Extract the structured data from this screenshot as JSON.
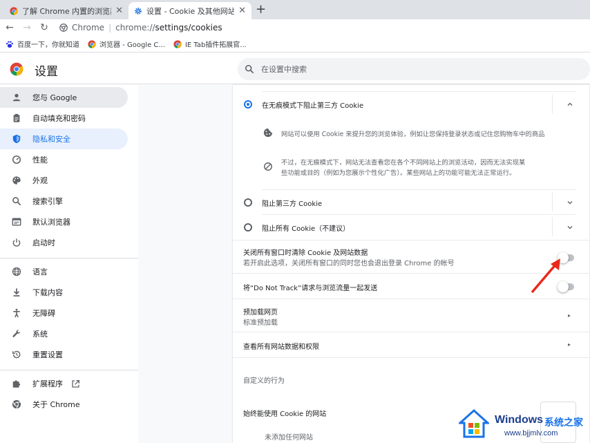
{
  "tabs": [
    {
      "label": "了解 Chrome 内置的浏览器工具",
      "active": false
    },
    {
      "label": "设置 - Cookie 及其他网站数据",
      "active": true
    }
  ],
  "omnibox": {
    "chip": "Chrome",
    "url_scheme": "chrome://",
    "url_path": "settings/cookies"
  },
  "bookmarks": [
    {
      "label": "百度一下，你就知道",
      "icon": "baidu-paw-icon"
    },
    {
      "label": "浏览器 - Google C...",
      "icon": "chrome-icon"
    },
    {
      "label": "IE Tab插件拓展官...",
      "icon": "chrome-icon"
    }
  ],
  "header": {
    "title": "设置",
    "search_placeholder": "在设置中搜索"
  },
  "sidebar": {
    "items": [
      {
        "label": "您与 Google",
        "icon": "person-icon"
      },
      {
        "label": "自动填充和密码",
        "icon": "clipboard-icon"
      },
      {
        "label": "隐私和安全",
        "icon": "shield-icon"
      },
      {
        "label": "性能",
        "icon": "speedometer-icon"
      },
      {
        "label": "外观",
        "icon": "palette-icon"
      },
      {
        "label": "搜索引擎",
        "icon": "search-icon"
      },
      {
        "label": "默认浏览器",
        "icon": "browser-icon"
      },
      {
        "label": "启动时",
        "icon": "power-icon"
      },
      {
        "label": "语言",
        "icon": "globe-icon"
      },
      {
        "label": "下载内容",
        "icon": "download-icon"
      },
      {
        "label": "无障碍",
        "icon": "accessibility-icon"
      },
      {
        "label": "系统",
        "icon": "wrench-icon"
      },
      {
        "label": "重置设置",
        "icon": "reset-icon"
      },
      {
        "label": "扩展程序",
        "icon": "puzzle-icon"
      },
      {
        "label": "关于 Chrome",
        "icon": "chrome-icon"
      }
    ]
  },
  "content": {
    "option_incognito": "在无痕模式下阻止第三方 Cookie",
    "detail_1": "网站可以使用 Cookie 来提升您的浏览体验，例如让您保持登录状态或记住您购物车中的商品",
    "detail_2_line1": "不过，在无痕模式下，网站无法查看您在各个不同网站上的浏览活动，因而无法实现某",
    "detail_2_line2": "些功能或目的（例如为您展示个性化广告）。某些网站上的功能可能无法正常运行。",
    "option_block_third": "阻止第三方 Cookie",
    "option_block_all": "阻止所有 Cookie（不建议）",
    "clear_on_exit_title": "关闭所有窗口时清除 Cookie 及网站数据",
    "clear_on_exit_sub": "若开启此选项，关闭所有窗口的同时您也会退出登录 Chrome 的帐号",
    "dnt_title": "将“Do Not Track”请求与浏览流量一起发送",
    "preload_title": "预加载网页",
    "preload_sub": "标准预加载",
    "view_all": "查看所有网站数据和权限",
    "custom_behavior": "自定义的行为",
    "always_allow": "始终能使用 Cookie 的网站",
    "no_sites": "未添加任何网站"
  },
  "watermark": {
    "brand": "Windows",
    "suffix": "系统之家",
    "url": "www.bjjmlv.com"
  },
  "colors": {
    "accent": "#1a73e8",
    "tabstrip": "#dee1e6",
    "selected_bg": "#e8f0fe",
    "arrow": "#e8291c"
  }
}
